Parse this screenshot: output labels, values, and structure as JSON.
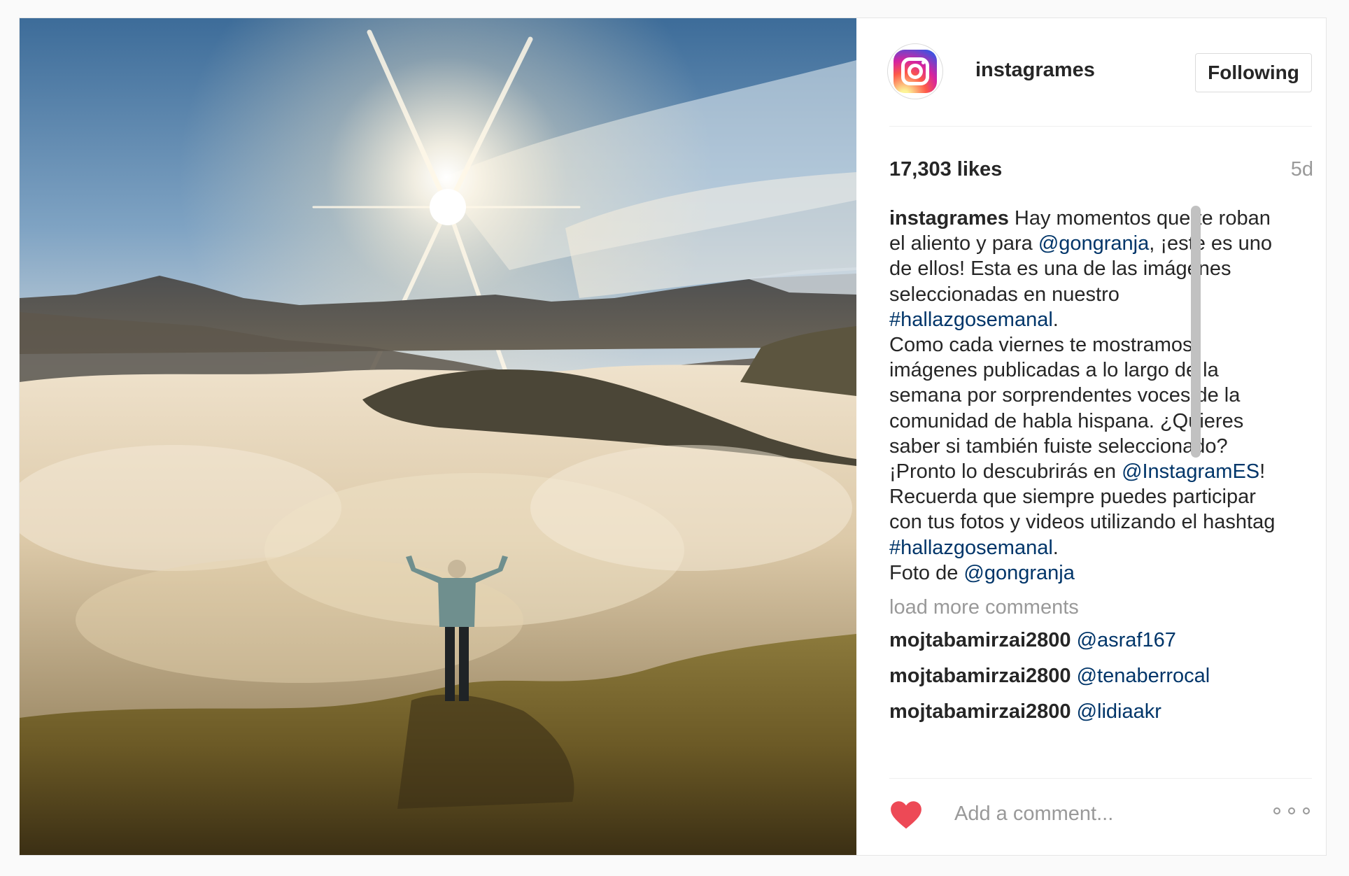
{
  "post": {
    "account": {
      "username": "instagrames",
      "avatar_icon": "instagram-logo-icon",
      "follow_label": "Following"
    },
    "likes": "17,303 likes",
    "age": "5d",
    "caption": {
      "author": "instagrames",
      "parts": [
        {
          "text": " Hay momentos que te roban el aliento y para ",
          "type": "text"
        },
        {
          "text": "@gongranja",
          "type": "link"
        },
        {
          "text": ", ¡este es uno de ellos! Esta es una de las imágenes seleccionadas en nuestro ",
          "type": "text"
        },
        {
          "text": "#hallazgosemanal",
          "type": "link"
        },
        {
          "text": ".",
          "type": "text"
        },
        {
          "text": "\n",
          "type": "br"
        },
        {
          "text": "Como cada viernes te mostramos imágenes publicadas a lo largo de la semana por sorprendentes voces de la comunidad de habla hispana. ¿Quieres saber si también fuiste seleccionado? ¡Pronto lo descubrirás en ",
          "type": "text"
        },
        {
          "text": "@InstagramES",
          "type": "link"
        },
        {
          "text": "!",
          "type": "text"
        },
        {
          "text": "\n",
          "type": "br"
        },
        {
          "text": "Recuerda que siempre puedes participar con tus fotos y videos utilizando el hashtag ",
          "type": "text"
        },
        {
          "text": "#hallazgosemanal",
          "type": "link"
        },
        {
          "text": ".",
          "type": "text"
        },
        {
          "text": "\n",
          "type": "br"
        },
        {
          "text": "Foto de ",
          "type": "text"
        },
        {
          "text": "@gongranja",
          "type": "link"
        }
      ]
    },
    "load_more": "load more comments",
    "comments": [
      {
        "user": "mojtabamirzai2800",
        "text": "@asraf167"
      },
      {
        "user": "mojtabamirzai2800",
        "text": "@tenaberrocal"
      },
      {
        "user": "mojtabamirzai2800",
        "text": "@lidiaakr"
      }
    ],
    "comment_placeholder": "Add a comment...",
    "icons": {
      "like": "heart-icon",
      "more": "more-options-icon"
    },
    "colors": {
      "heart": "#ed4956",
      "link": "#003569",
      "muted": "#999999"
    }
  }
}
